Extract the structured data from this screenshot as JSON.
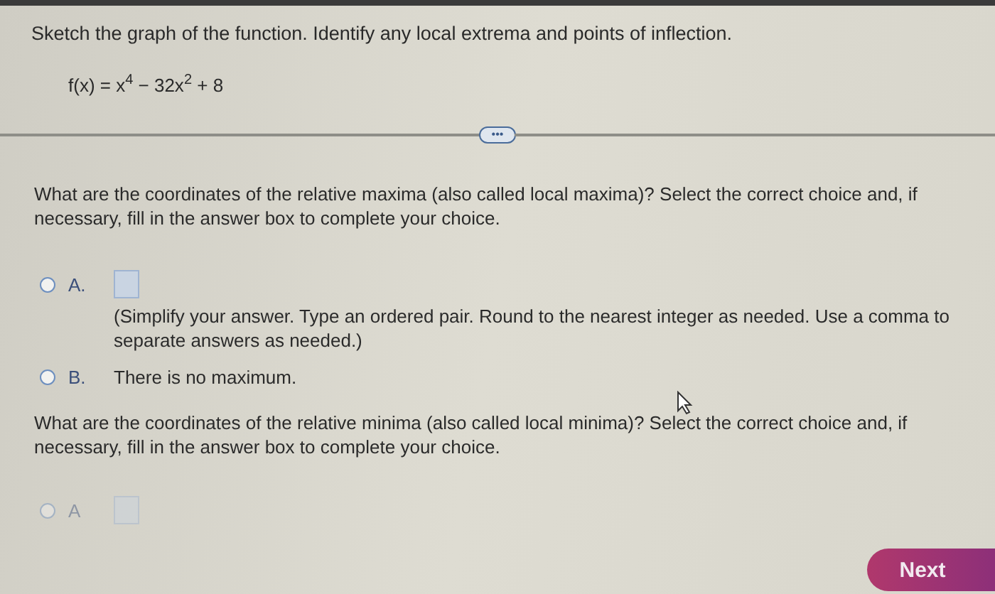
{
  "instruction": "Sketch the graph of the function. Identify any local extrema and points of inflection.",
  "function": "f(x) = x$^{4}$ − 32x$^{2}$ + 8",
  "expand_button": "•••",
  "questions": [
    {
      "prompt": "What are the coordinates of the relative maxima (also called local maxima)? Select the correct choice and, if necessary, fill in the answer box to complete your choice.",
      "choices": [
        {
          "letter": "A.",
          "kind": "answer",
          "selected": false,
          "hint": "(Simplify your answer. Type an ordered pair. Round to the nearest integer as needed. Use a comma to separate answers as needed.)"
        },
        {
          "letter": "B.",
          "kind": "text",
          "selected": false,
          "text": "There is no maximum."
        }
      ]
    },
    {
      "prompt": "What are the coordinates of the relative minima (also called local minima)? Select the correct choice and, if necessary, fill in the answer box to complete your choice.",
      "choices": [
        {
          "letter": "A",
          "kind": "answer",
          "selected": false
        }
      ]
    }
  ],
  "next_button": "Next"
}
